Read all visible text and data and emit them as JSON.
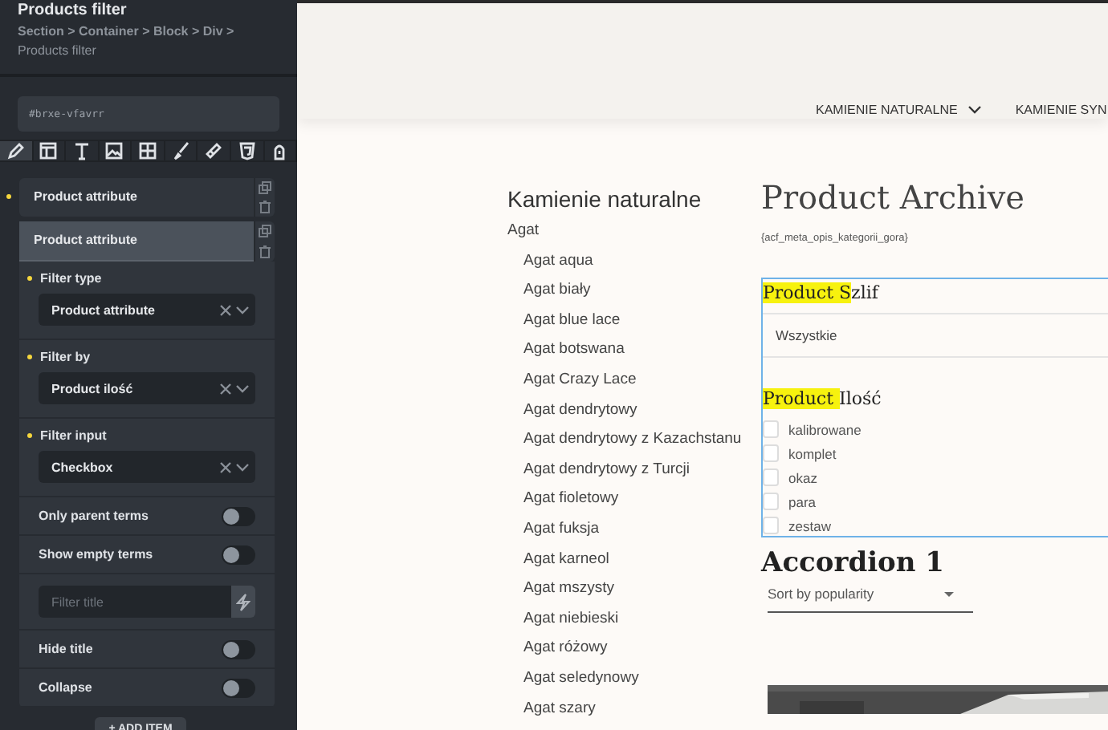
{
  "panel": {
    "title": "Products filter",
    "breadcrumb": "Section > Container > Block > Div >",
    "current": "Products filter",
    "element_id": "#brxe-vfavrr",
    "tabs": [
      {
        "selected": true
      },
      {
        "selected": false
      },
      {
        "selected": false
      },
      {
        "selected": false
      },
      {
        "selected": false
      },
      {
        "selected": false
      },
      {
        "selected": false
      },
      {
        "selected": false
      },
      {
        "selected": false
      }
    ],
    "items": [
      {
        "label": "Product attribute",
        "expanded": false
      },
      {
        "label": "Product attribute",
        "expanded": true
      }
    ],
    "fields": [
      {
        "kind": "select",
        "label": "Filter type",
        "value": "Product attribute"
      },
      {
        "kind": "select",
        "label": "Filter by",
        "value": "Product ilość"
      },
      {
        "kind": "select",
        "label": "Filter input",
        "value": "Checkbox"
      },
      {
        "kind": "toggle",
        "label": "Only parent terms",
        "on": false
      },
      {
        "kind": "toggle",
        "label": "Show empty terms",
        "on": false
      },
      {
        "kind": "input",
        "placeholder": "Filter title"
      },
      {
        "kind": "toggle",
        "label": "Hide title",
        "on": false
      },
      {
        "kind": "toggle",
        "label": "Collapse",
        "on": false
      }
    ],
    "add_button": "+ ADD ITEM"
  },
  "nav": [
    {
      "label": "KAMIENIE NATURALNE",
      "dropdown": true
    },
    {
      "label": "KAMIENIE SYN",
      "dropdown": false
    }
  ],
  "categories": {
    "title": "Kamienie naturalne",
    "items": [
      {
        "label": "Agat",
        "children": [
          {
            "label": "Agat aqua"
          },
          {
            "label": "Agat biały"
          },
          {
            "label": "Agat blue lace"
          },
          {
            "label": "Agat botswana"
          },
          {
            "label": "Agat Crazy Lace"
          },
          {
            "label": "Agat dendrytowy"
          },
          {
            "label": "Agat dendrytowy z Kazachstanu"
          },
          {
            "label": "Agat dendrytowy z Turcji"
          },
          {
            "label": "Agat fioletowy"
          },
          {
            "label": "Agat fuksja"
          },
          {
            "label": "Agat karneol"
          },
          {
            "label": "Agat mszysty"
          },
          {
            "label": "Agat niebieski"
          },
          {
            "label": "Agat różowy"
          },
          {
            "label": "Agat seledynowy"
          },
          {
            "label": "Agat szary"
          }
        ]
      }
    ]
  },
  "archive": {
    "title": "Product Archive",
    "meta": "{acf_meta_opis_kategorii_gora}",
    "filters": [
      {
        "kind": "select",
        "title_highlight": "Product S",
        "title_rest": "zlif",
        "value": "Wszystkie"
      },
      {
        "kind": "checkboxes",
        "title_highlight": "Product ",
        "title_rest": "Ilość",
        "options": [
          {
            "label": "kalibrowane",
            "checked": false
          },
          {
            "label": "komplet",
            "checked": false
          },
          {
            "label": "okaz",
            "checked": false
          },
          {
            "label": "para",
            "checked": false
          },
          {
            "label": "zestaw",
            "checked": false
          }
        ]
      }
    ],
    "accordion": "Accordion 1",
    "sort": "Sort by popularity"
  }
}
